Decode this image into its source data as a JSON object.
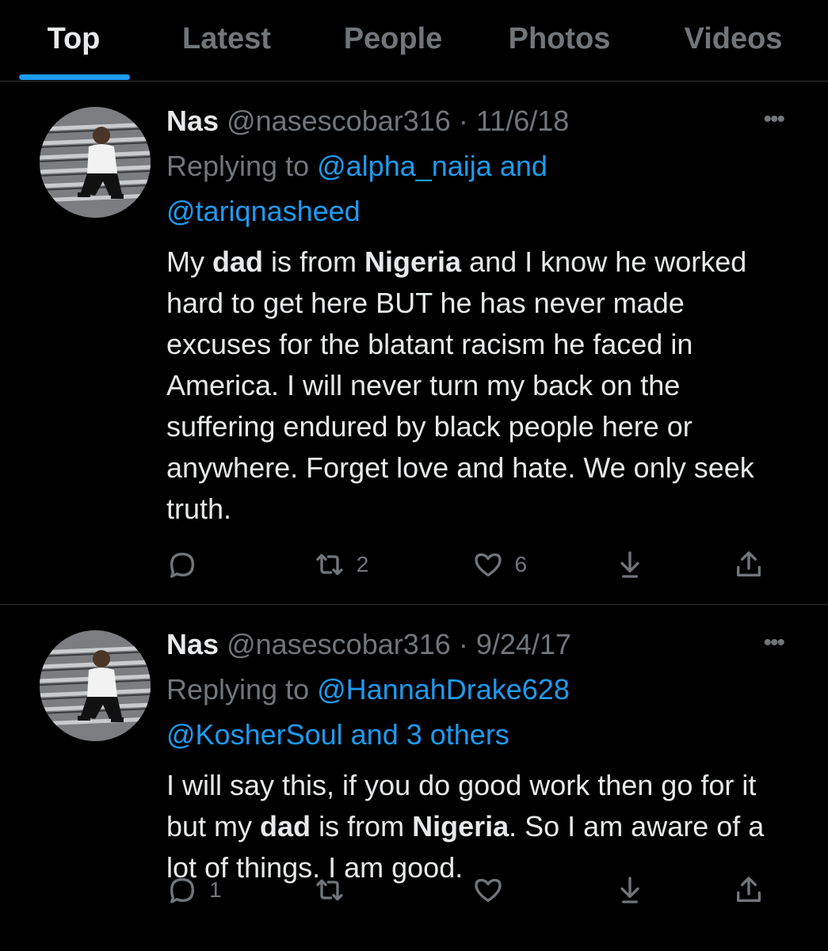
{
  "tabs": [
    "Top",
    "Latest",
    "People",
    "Photos",
    "Videos"
  ],
  "tweets": [
    {
      "author": "Nas",
      "handle": "@nasescobar316",
      "date": "11/6/18",
      "replying_prefix": "Replying to ",
      "mention_line1": "@alpha_naija and",
      "mention_line2": "@tariqnasheed",
      "text_segments": [
        "My ",
        "dad",
        " is from ",
        "Nigeria",
        " and I know he worked hard to get here BUT he has never made excuses for the blatant racism he faced in America. I will never turn my back on the suffering endured by black people here or anywhere. Forget love and hate. We only seek truth."
      ],
      "replies": "",
      "retweets": "2",
      "likes": "6"
    },
    {
      "author": "Nas",
      "handle": "@nasescobar316",
      "date": "9/24/17",
      "replying_prefix": "Replying to ",
      "mention_line1": "@HannahDrake628",
      "mention_line2": "@KosherSoul and 3 others",
      "text_segments": [
        "I will say this, if you do good work then go for it but my ",
        "dad",
        " is from ",
        "Nigeria",
        ". So I am aware of a lot of things. I am good."
      ],
      "replies": "1",
      "retweets": "",
      "likes": ""
    }
  ],
  "icons": {
    "more": "ellipsis-icon",
    "reply": "reply-bubble-icon",
    "retweet": "retweet-icon",
    "like": "heart-icon",
    "download": "download-icon",
    "share": "share-icon"
  },
  "colors": {
    "background": "#000000",
    "primary_text": "#e7e9ea",
    "secondary_text": "#71767b",
    "accent": "#1d9bf0",
    "divider": "#2f3336"
  }
}
